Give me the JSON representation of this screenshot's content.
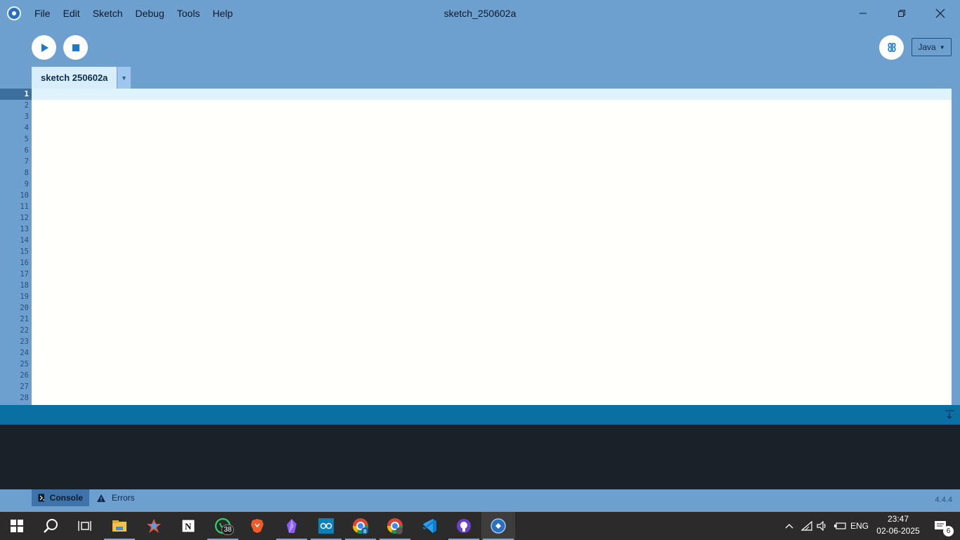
{
  "window": {
    "title": "sketch_250602a",
    "menu": [
      "File",
      "Edit",
      "Sketch",
      "Debug",
      "Tools",
      "Help"
    ]
  },
  "toolbar": {
    "run_icon": "play-icon",
    "stop_icon": "stop-icon",
    "debugger_icon": "butterfly-icon",
    "mode": "Java"
  },
  "tabs": [
    {
      "label": "sketch 250602a"
    }
  ],
  "editor": {
    "line_numbers": [
      "1",
      "2",
      "3",
      "4",
      "5",
      "6",
      "7",
      "8",
      "9",
      "10",
      "11",
      "12",
      "13",
      "14",
      "15",
      "16",
      "17",
      "18",
      "19",
      "20",
      "21",
      "22",
      "23",
      "24",
      "25",
      "26",
      "27",
      "28"
    ],
    "current_line": "1"
  },
  "footer": {
    "console_label": "Console",
    "errors_label": "Errors",
    "version": "4.4.4"
  },
  "taskbar": {
    "apps": [
      {
        "name": "file-explorer-icon",
        "running": true
      },
      {
        "name": "app-icon-2",
        "running": false
      },
      {
        "name": "notion-icon",
        "running": false
      },
      {
        "name": "whatsapp-icon",
        "running": true,
        "badge": "38"
      },
      {
        "name": "brave-icon",
        "running": false
      },
      {
        "name": "obsidian-icon",
        "running": true
      },
      {
        "name": "arduino-icon",
        "running": true
      },
      {
        "name": "chrome-profile-b-icon",
        "running": true
      },
      {
        "name": "chrome-icon",
        "running": true
      },
      {
        "name": "vscode-icon",
        "running": false
      },
      {
        "name": "github-desktop-icon",
        "running": true
      },
      {
        "name": "processing-icon",
        "running": true,
        "active": true
      }
    ],
    "language": "ENG",
    "time": "23:47",
    "date": "02-06-2025",
    "notifications": "6"
  },
  "colors": {
    "window_bg": "#6ea0cf",
    "editor_bg": "#fffffb",
    "current_line": "#dff3fd",
    "divider": "#0a70a4",
    "console_bg": "#1b2129",
    "taskbar": "#2b2b2b"
  }
}
